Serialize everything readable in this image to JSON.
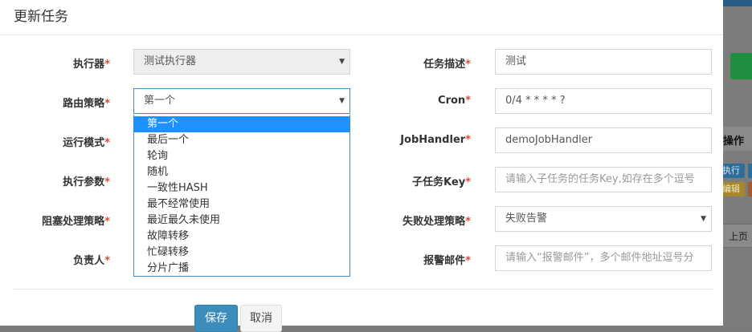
{
  "modal": {
    "title": "更新任务"
  },
  "form": {
    "executor": {
      "label": "执行器",
      "value": "测试执行器"
    },
    "route_strategy": {
      "label": "路由策略",
      "value": "第一个"
    },
    "run_mode": {
      "label": "运行模式"
    },
    "exec_param": {
      "label": "执行参数"
    },
    "block_strategy": {
      "label": "阻塞处理策略"
    },
    "owner": {
      "label": "负责人"
    },
    "job_desc": {
      "label": "任务描述",
      "value": "测试"
    },
    "cron": {
      "label": "Cron",
      "value": "0/4 * * * * ?"
    },
    "job_handler": {
      "label": "JobHandler",
      "value": "demoJobHandler"
    },
    "child_job": {
      "label": "子任务Key",
      "placeholder": "请输入子任务的任务Key,如存在多个逗号"
    },
    "fail_strategy": {
      "label": "失败处理策略",
      "value": "失败告警"
    },
    "alarm_email": {
      "label": "报警邮件",
      "placeholder": "请输入“报警邮件”，多个邮件地址逗号分"
    },
    "required_mark": "*"
  },
  "route_options": [
    "第一个",
    "最后一个",
    "轮询",
    "随机",
    "一致性HASH",
    "最不经常使用",
    "最近最久未使用",
    "故障转移",
    "忙碌转移",
    "分片广播"
  ],
  "buttons": {
    "save": "保存",
    "cancel": "取消"
  },
  "background": {
    "col_header": "操作",
    "btn_exec": "执行",
    "btn_edit": "编辑",
    "pager_prev": "上页"
  },
  "colors": {
    "primary": "#3c8dbc",
    "required": "#dd4b39",
    "selected_option": "#1e90ff"
  }
}
